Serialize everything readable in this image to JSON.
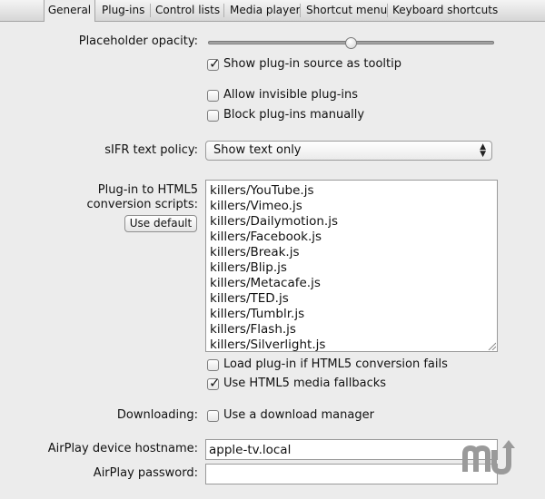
{
  "tabs": [
    {
      "label": "General",
      "active": true
    },
    {
      "label": "Plug-ins",
      "active": false
    },
    {
      "label": "Control lists",
      "active": false
    },
    {
      "label": "Media player",
      "active": false
    },
    {
      "label": "Shortcut menu",
      "active": false
    },
    {
      "label": "Keyboard shortcuts",
      "active": false
    }
  ],
  "placeholder_opacity": {
    "label": "Placeholder opacity:",
    "value_fraction": 0.5
  },
  "options": {
    "show_source_tooltip": {
      "label": "Show plug-in source as tooltip",
      "checked": true
    },
    "allow_invisible": {
      "label": "Allow invisible plug-ins",
      "checked": false
    },
    "block_manually": {
      "label": "Block plug-ins manually",
      "checked": false
    },
    "load_plugin_on_fail": {
      "label": "Load plug-in if HTML5 conversion fails",
      "checked": false
    },
    "html5_fallbacks": {
      "label": "Use HTML5 media fallbacks",
      "checked": true
    },
    "download_manager": {
      "label": "Use a download manager",
      "checked": false
    }
  },
  "sifr": {
    "label": "sIFR text policy:",
    "selected": "Show text only"
  },
  "conversion": {
    "label_line1": "Plug-in to HTML5",
    "label_line2": "conversion scripts:",
    "button_label": "Use default",
    "scripts": [
      "killers/YouTube.js",
      "killers/Vimeo.js",
      "killers/Dailymotion.js",
      "killers/Facebook.js",
      "killers/Break.js",
      "killers/Blip.js",
      "killers/Metacafe.js",
      "killers/TED.js",
      "killers/Tumblr.js",
      "killers/Flash.js",
      "killers/Silverlight.js"
    ]
  },
  "downloading": {
    "label": "Downloading:"
  },
  "airplay": {
    "hostname_label": "AirPlay device hostname:",
    "hostname_value": "apple-tv.local",
    "password_label": "AirPlay password:",
    "password_value": ""
  },
  "colors": {
    "window_bg": "#ececec",
    "field_bg": "#ffffff",
    "watermark": "#9a9a9a"
  },
  "icons": {
    "checkmark": "checkmark-icon",
    "select_arrows": "updown-arrows-icon",
    "resize_grip": "resize-grip-icon",
    "watermark_logo": "mu-logo-icon"
  }
}
